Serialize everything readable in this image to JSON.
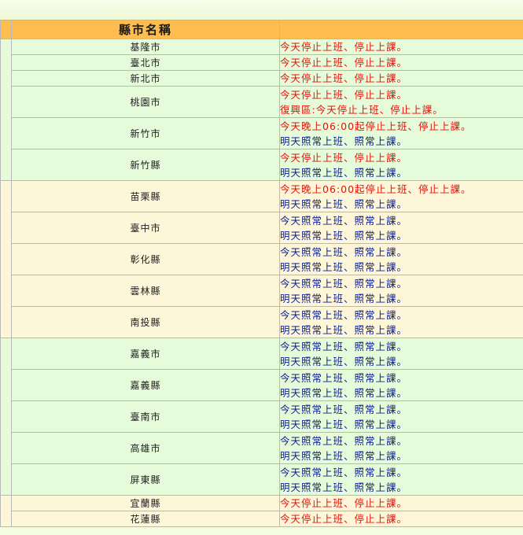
{
  "table": {
    "header": {
      "city_col": "縣市名稱",
      "status_col": ""
    },
    "rows": [
      {
        "group": "north",
        "name": "基隆市",
        "lines": [
          {
            "text": "今天停止上班、停止上課。",
            "color": "red"
          }
        ]
      },
      {
        "group": "north",
        "name": "臺北市",
        "lines": [
          {
            "text": "今天停止上班、停止上課。",
            "color": "red"
          }
        ]
      },
      {
        "group": "north",
        "name": "新北市",
        "lines": [
          {
            "text": "今天停止上班、停止上課。",
            "color": "red"
          }
        ]
      },
      {
        "group": "north",
        "name": "桃園市",
        "lines": [
          {
            "text": "今天停止上班、停止上課。",
            "color": "red"
          },
          {
            "text": "復興區:今天停止上班、停止上課。",
            "color": "red"
          }
        ]
      },
      {
        "group": "north",
        "name": "新竹市",
        "lines": [
          {
            "text": "今天晚上06:00起停止上班、停止上課。",
            "color": "red"
          },
          {
            "text": "明天照常上班、照常上課。",
            "color": "blue"
          }
        ]
      },
      {
        "group": "north",
        "name": "新竹縣",
        "lines": [
          {
            "text": "今天停止上班、停止上課。",
            "color": "red"
          },
          {
            "text": "明天照常上班、照常上課。",
            "color": "blue"
          }
        ]
      },
      {
        "group": "central",
        "name": "苗栗縣",
        "lines": [
          {
            "text": "今天晚上06:00起停止上班、停止上課。",
            "color": "red"
          },
          {
            "text": "明天照常上班、照常上課。",
            "color": "blue"
          }
        ]
      },
      {
        "group": "central",
        "name": "臺中市",
        "lines": [
          {
            "text": "今天照常上班、照常上課。",
            "color": "blue"
          },
          {
            "text": "明天照常上班、照常上課。",
            "color": "blue"
          }
        ]
      },
      {
        "group": "central",
        "name": "彰化縣",
        "lines": [
          {
            "text": "今天照常上班、照常上課。",
            "color": "blue"
          },
          {
            "text": "明天照常上班、照常上課。",
            "color": "blue"
          }
        ]
      },
      {
        "group": "central",
        "name": "雲林縣",
        "lines": [
          {
            "text": "今天照常上班、照常上課。",
            "color": "blue"
          },
          {
            "text": "明天照常上班、照常上課。",
            "color": "blue"
          }
        ]
      },
      {
        "group": "central",
        "name": "南投縣",
        "lines": [
          {
            "text": "今天照常上班、照常上課。",
            "color": "blue"
          },
          {
            "text": "明天照常上班、照常上課。",
            "color": "blue"
          }
        ]
      },
      {
        "group": "south",
        "name": "嘉義市",
        "lines": [
          {
            "text": "今天照常上班、照常上課。",
            "color": "blue"
          },
          {
            "text": "明天照常上班、照常上課。",
            "color": "blue"
          }
        ]
      },
      {
        "group": "south",
        "name": "嘉義縣",
        "lines": [
          {
            "text": "今天照常上班、照常上課。",
            "color": "blue"
          },
          {
            "text": "明天照常上班、照常上課。",
            "color": "blue"
          }
        ]
      },
      {
        "group": "south",
        "name": "臺南市",
        "lines": [
          {
            "text": "今天照常上班、照常上課。",
            "color": "blue"
          },
          {
            "text": "明天照常上班、照常上課。",
            "color": "blue"
          }
        ]
      },
      {
        "group": "south",
        "name": "高雄市",
        "lines": [
          {
            "text": "今天照常上班、照常上課。",
            "color": "blue"
          },
          {
            "text": "明天照常上班、照常上課。",
            "color": "blue"
          }
        ]
      },
      {
        "group": "south",
        "name": "屏東縣",
        "lines": [
          {
            "text": "今天照常上班、照常上課。",
            "color": "blue"
          },
          {
            "text": "明天照常上班、照常上課。",
            "color": "blue"
          }
        ]
      },
      {
        "group": "east",
        "name": "宜蘭縣",
        "lines": [
          {
            "text": "今天停止上班、停止上課。",
            "color": "red"
          }
        ]
      },
      {
        "group": "east",
        "name": "花蓮縣",
        "lines": [
          {
            "text": "今天停止上班、停止上課。",
            "color": "red"
          }
        ]
      }
    ]
  },
  "colors": {
    "header_bg": "#ffbc4f",
    "north_south_bg": "#e6fbd9",
    "central_east_bg": "#fdf6d8",
    "stop_text": "#e3120b",
    "normal_text": "#0d1f8c"
  }
}
